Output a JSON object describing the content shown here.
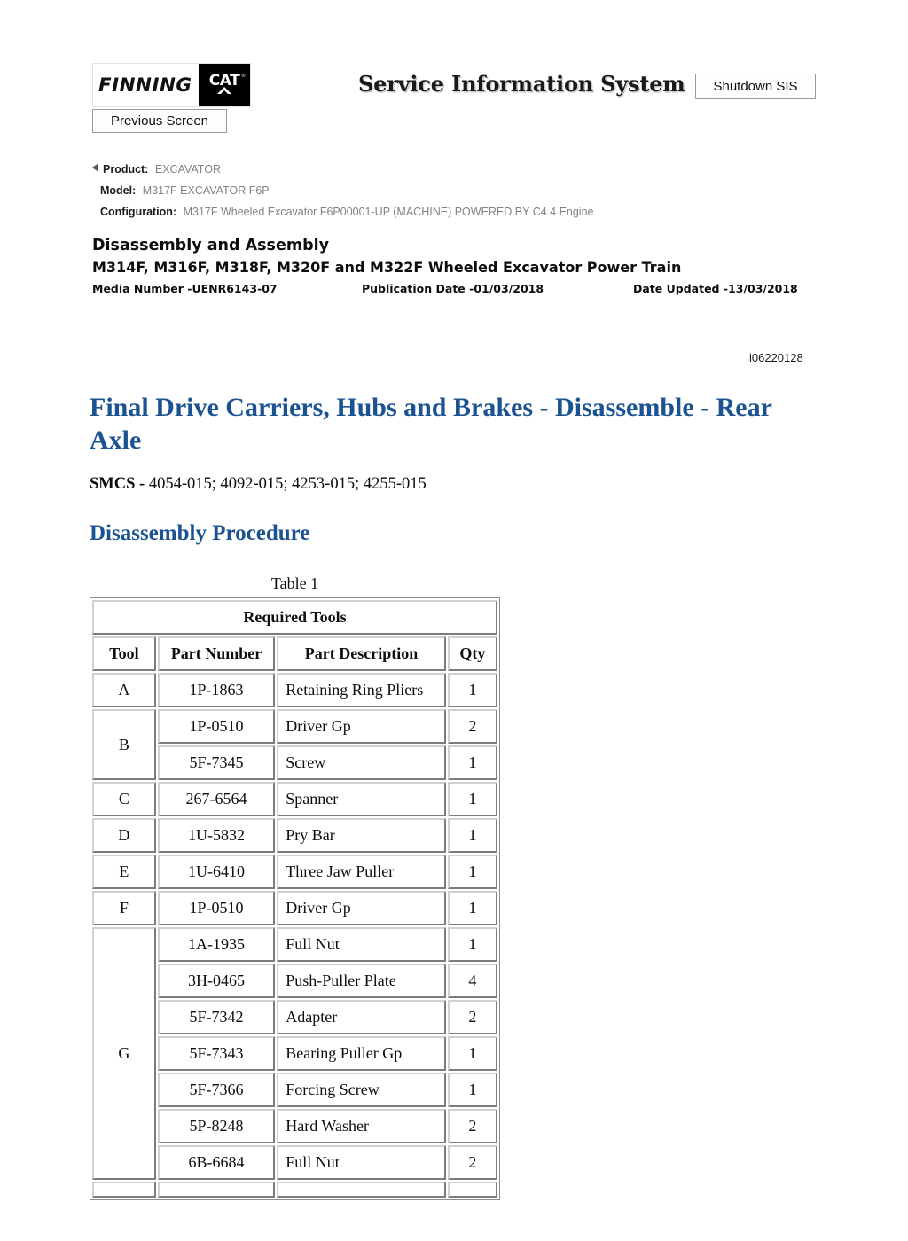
{
  "header": {
    "logo_finning": "FINNING",
    "logo_cat": "CAT",
    "sis_title": "Service Information System",
    "shutdown_button": "Shutdown SIS",
    "previous_button": "Previous Screen"
  },
  "breadcrumb": [
    {
      "label": "Product:",
      "value": "EXCAVATOR"
    },
    {
      "label": "Model:",
      "value": "M317F EXCAVATOR F6P"
    },
    {
      "label": "Configuration:",
      "value": "M317F Wheeled Excavator F6P00001-UP (MACHINE) POWERED BY C4.4 Engine"
    }
  ],
  "document": {
    "heading1": "Disassembly and Assembly",
    "heading2": "M314F, M316F, M318F, M320F and M322F Wheeled Excavator Power Train",
    "media_number": "Media Number -UENR6143-07",
    "publication_date": "Publication Date -01/03/2018",
    "date_updated": "Date Updated -13/03/2018",
    "doc_id": "i06220128"
  },
  "article": {
    "title": "Final Drive Carriers, Hubs and Brakes - Disassemble - Rear Axle",
    "smcs_label": "SMCS -",
    "smcs_codes": "4054-015; 4092-015; 4253-015; 4255-015",
    "section_heading": "Disassembly Procedure"
  },
  "table": {
    "caption": "Table 1",
    "title": "Required Tools",
    "columns": [
      "Tool",
      "Part Number",
      "Part Description",
      "Qty"
    ],
    "rows": [
      {
        "tool": "A",
        "part": "1P-1863",
        "desc": "Retaining Ring Pliers",
        "qty": "1"
      },
      {
        "tool": "B",
        "part": "1P-0510",
        "desc": "Driver Gp",
        "qty": "2"
      },
      {
        "tool": "",
        "part": "5F-7345",
        "desc": "Screw",
        "qty": "1"
      },
      {
        "tool": "C",
        "part": "267-6564",
        "desc": "Spanner",
        "qty": "1"
      },
      {
        "tool": "D",
        "part": "1U-5832",
        "desc": "Pry Bar",
        "qty": "1"
      },
      {
        "tool": "E",
        "part": "1U-6410",
        "desc": "Three Jaw Puller",
        "qty": "1"
      },
      {
        "tool": "F",
        "part": "1P-0510",
        "desc": "Driver Gp",
        "qty": "1"
      },
      {
        "tool": "G",
        "part": "1A-1935",
        "desc": "Full Nut",
        "qty": "1"
      },
      {
        "tool": "",
        "part": "3H-0465",
        "desc": "Push-Puller Plate",
        "qty": "4"
      },
      {
        "tool": "",
        "part": "5F-7342",
        "desc": "Adapter",
        "qty": "2"
      },
      {
        "tool": "",
        "part": "5F-7343",
        "desc": "Bearing Puller Gp",
        "qty": "1"
      },
      {
        "tool": "",
        "part": "5F-7366",
        "desc": "Forcing Screw",
        "qty": "1"
      },
      {
        "tool": "",
        "part": "5P-8248",
        "desc": "Hard Washer",
        "qty": "2"
      },
      {
        "tool": "",
        "part": "6B-6684",
        "desc": "Full Nut",
        "qty": "2"
      }
    ]
  },
  "colors": {
    "heading_blue": "#1b5392",
    "breadcrumb_value_gray": "#828282",
    "page_background": "#ffffff"
  }
}
